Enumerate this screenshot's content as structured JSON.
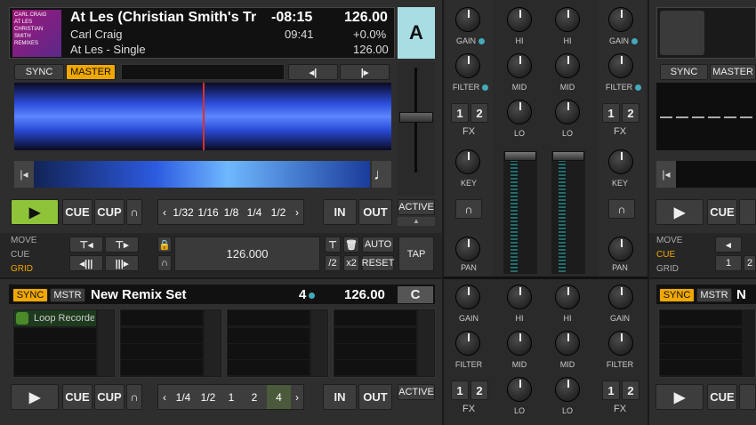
{
  "deckA": {
    "title": "At Les (Christian Smith's Tr",
    "remaining": "-08:15",
    "bpm": "126.00",
    "artist": "Carl Craig",
    "elapsed": "09:41",
    "pitch": "+0.0%",
    "album": "At Les - Single",
    "bpm2": "126.00",
    "letter": "A",
    "cover_line1": "CARL CRAIG",
    "cover_line2": "AT LES",
    "cover_line3": "CHRISTIAN SMITH",
    "cover_line4": "REMIXES",
    "sync": "SYNC",
    "master": "MASTER",
    "prev": "◂|",
    "next": "|▸",
    "play": "▶",
    "cue": "CUE",
    "cup": "CUP",
    "flux": "∩",
    "loops": [
      "1/32",
      "1/16",
      "1/8",
      "1/4",
      "1/2"
    ],
    "in": "IN",
    "out": "OUT",
    "active": "ACTIVE",
    "modes": [
      "MOVE",
      "CUE",
      "GRID"
    ],
    "grid_bpm": "126.000",
    "auto": "AUTO",
    "half": "/2",
    "double": "x2",
    "reset": "RESET",
    "tap": "TAP"
  },
  "deckC": {
    "sync": "SYNC",
    "mstr": "MSTR",
    "title": "New Remix Set",
    "beats": "4",
    "bpm": "126.00",
    "letter": "C",
    "slot_label": "Loop Recorder",
    "play": "▶",
    "cue": "CUE",
    "cup": "CUP",
    "flux": "∩",
    "loops": [
      "1/4",
      "1/2",
      "1",
      "2",
      "4"
    ],
    "in": "IN",
    "out": "OUT",
    "active": "ACTIVE"
  },
  "deckB": {
    "sync": "SYNC",
    "master": "MASTER",
    "play": "▶",
    "cue": "CUE",
    "modes": [
      "MOVE",
      "CUE",
      "GRID"
    ],
    "loop1": "1",
    "loop2": "2"
  },
  "deckD": {
    "sync": "SYNC",
    "mstr": "MSTR",
    "title": "N",
    "play": "▶",
    "cue": "CUE"
  },
  "mixer": {
    "gain": "GAIN",
    "hi": "HI",
    "mid": "MID",
    "lo": "LO",
    "filter": "FILTER",
    "fx": "FX",
    "key": "KEY",
    "pan": "PAN",
    "fx1": "1",
    "fx2": "2"
  }
}
